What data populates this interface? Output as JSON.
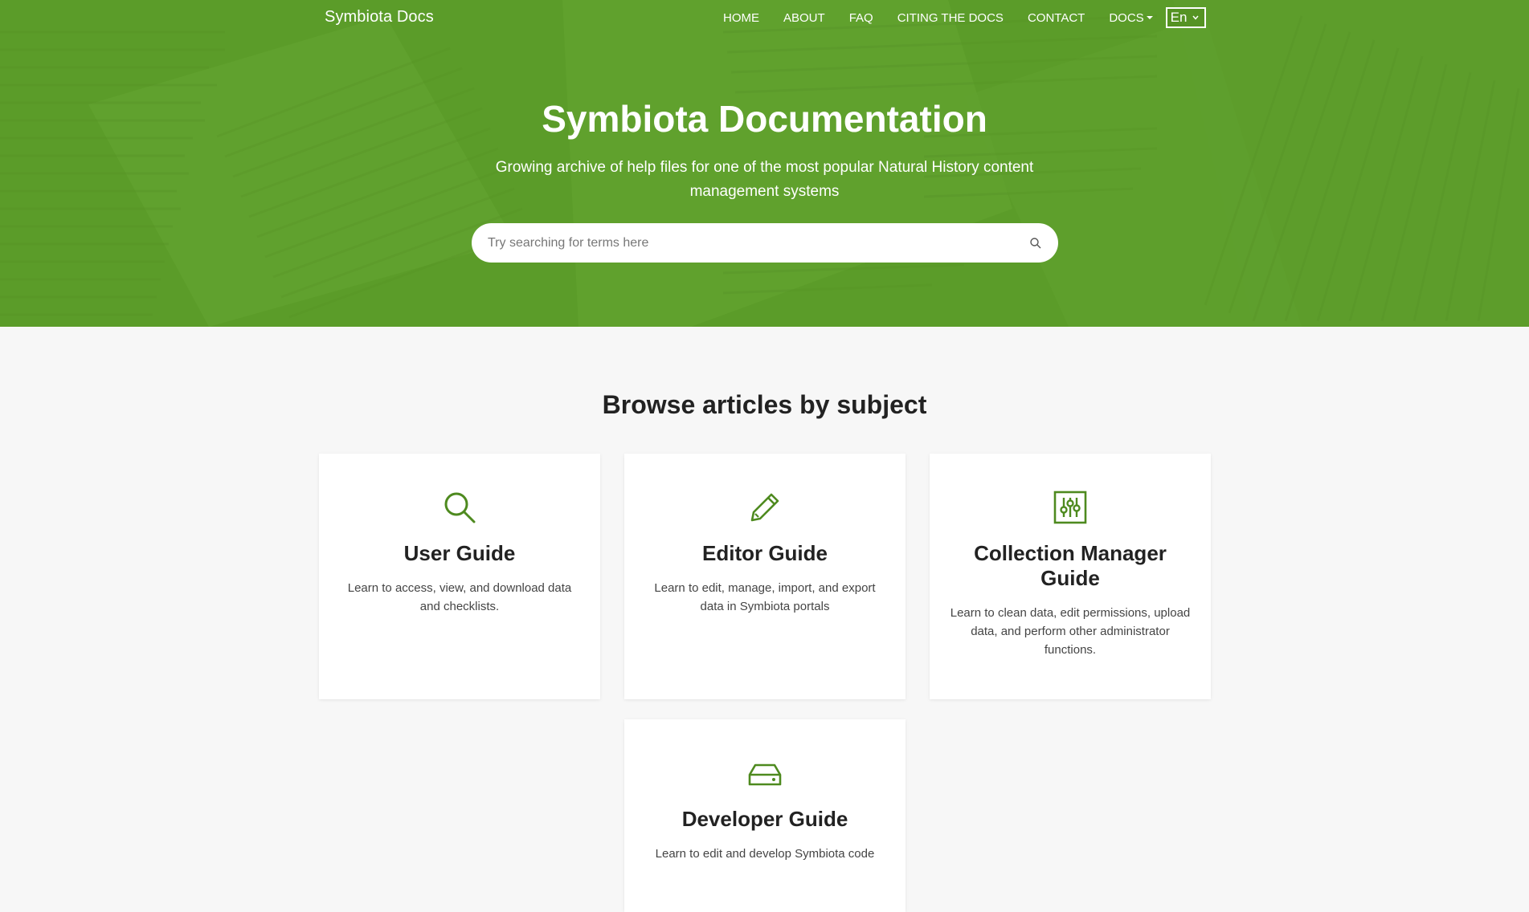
{
  "navbar": {
    "brand": "Symbiota Docs",
    "links": [
      "HOME",
      "ABOUT",
      "FAQ",
      "CITING THE DOCS",
      "CONTACT"
    ],
    "docs_label": "DOCS",
    "language": "En"
  },
  "hero": {
    "title": "Symbiota Documentation",
    "subtitle": "Growing archive of help files for one of the most popular Natural History content management systems",
    "search_placeholder": "Try searching for terms here"
  },
  "main": {
    "section_title": "Browse articles by subject",
    "cards": [
      {
        "icon": "search-icon",
        "title": "User Guide",
        "description": "Learn to access, view, and download data and checklists."
      },
      {
        "icon": "pencil-icon",
        "title": "Editor Guide",
        "description": "Learn to edit, manage, import, and export data in Symbiota portals"
      },
      {
        "icon": "sliders-icon",
        "title": "Collection Manager Guide",
        "description": "Learn to clean data, edit permissions, upload data, and perform other administrator functions."
      },
      {
        "icon": "hard-drive-icon",
        "title": "Developer Guide",
        "description": "Learn to edit and develop Symbiota code"
      }
    ]
  },
  "colors": {
    "accent": "#4e8a1f",
    "hero_bg": "#5e9c2a",
    "page_bg": "#f7f7f7"
  }
}
